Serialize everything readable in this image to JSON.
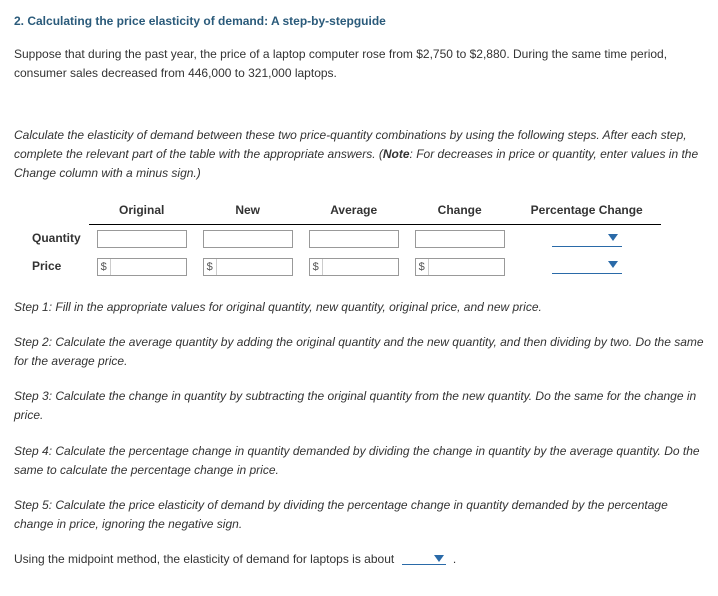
{
  "title": "2. Calculating the price elasticity of demand: A step-by-stepguide",
  "intro1": "Suppose that during the past year, the price of a laptop computer rose from $2,750 to $2,880. During the same time period, consumer sales decreased from 446,000 to 321,000 laptops.",
  "instruction_pre": "Calculate the elasticity of demand between these two price-quantity combinations by using the following steps. After each step, complete the relevant part of the table with the appropriate answers. (",
  "instruction_note_label": "Note",
  "instruction_note_text": ": For decreases in price or quantity, enter values in the Change column with a minus sign.)",
  "table": {
    "headers": {
      "original": "Original",
      "new": "New",
      "average": "Average",
      "change": "Change",
      "pct": "Percentage Change"
    },
    "rows": {
      "quantity": "Quantity",
      "price": "Price"
    },
    "currency": "$"
  },
  "steps": {
    "s1": "Step 1: Fill in the appropriate values for original quantity, new quantity, original price, and new price.",
    "s2": "Step 2: Calculate the average quantity by adding the original quantity and the new quantity, and then dividing by two. Do the same for the average price.",
    "s3": "Step 3: Calculate the change in quantity by subtracting the original quantity from the new quantity. Do the same for the change in price.",
    "s4": "Step 4: Calculate the percentage change in quantity demanded by dividing the change in quantity by the average quantity. Do the same to calculate the percentage change in price.",
    "s5": "Step 5: Calculate the price elasticity of demand by dividing the percentage change in quantity demanded by the percentage change in price, ignoring the negative sign."
  },
  "final_pre": "Using the midpoint method, the elasticity of demand for laptops is about ",
  "final_post": " ."
}
